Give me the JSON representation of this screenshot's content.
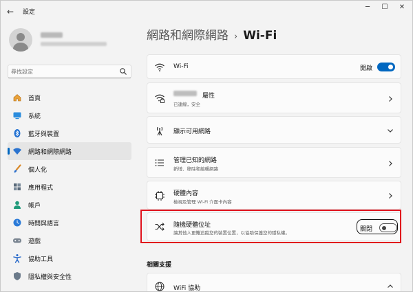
{
  "window": {
    "title": "設定"
  },
  "search": {
    "placeholder": "尋找設定"
  },
  "sidebar": {
    "items": [
      {
        "label": "首頁",
        "icon": "home-icon"
      },
      {
        "label": "系統",
        "icon": "system-icon"
      },
      {
        "label": "藍牙與裝置",
        "icon": "bluetooth-icon"
      },
      {
        "label": "網路和網際網路",
        "icon": "wifi-icon",
        "active": true
      },
      {
        "label": "個人化",
        "icon": "brush-icon"
      },
      {
        "label": "應用程式",
        "icon": "apps-icon"
      },
      {
        "label": "帳戶",
        "icon": "account-icon"
      },
      {
        "label": "時間與語言",
        "icon": "globe-clock-icon"
      },
      {
        "label": "遊戲",
        "icon": "gamepad-icon"
      },
      {
        "label": "協助工具",
        "icon": "accessibility-icon"
      },
      {
        "label": "隱私權與安全性",
        "icon": "shield-icon"
      }
    ]
  },
  "breadcrumb": {
    "parent": "網路和網際網路",
    "separator": "›",
    "current": "Wi-Fi"
  },
  "cards": {
    "wifi": {
      "title": "Wi-Fi",
      "state": "開啟",
      "on": true
    },
    "network": {
      "title": "屬性",
      "subtitle": "已連線，安全"
    },
    "available": {
      "title": "顯示可用網路"
    },
    "known": {
      "title": "管理已知的網路",
      "subtitle": "新增、移除和編輯網路"
    },
    "hardware": {
      "title": "硬體內容",
      "subtitle": "檢視及管理 Wi-Fi 介面卡內容"
    },
    "random": {
      "title": "隨機硬體位址",
      "subtitle": "讓其他人更難追蹤您的裝置位置，以協助保護您的隱私權。",
      "state": "關閉",
      "on": false
    },
    "help": {
      "title": "WiFi 協助"
    }
  },
  "related": {
    "title": "相關支援"
  },
  "colors": {
    "accent": "#0067c0",
    "highlight": "#e0121c"
  }
}
